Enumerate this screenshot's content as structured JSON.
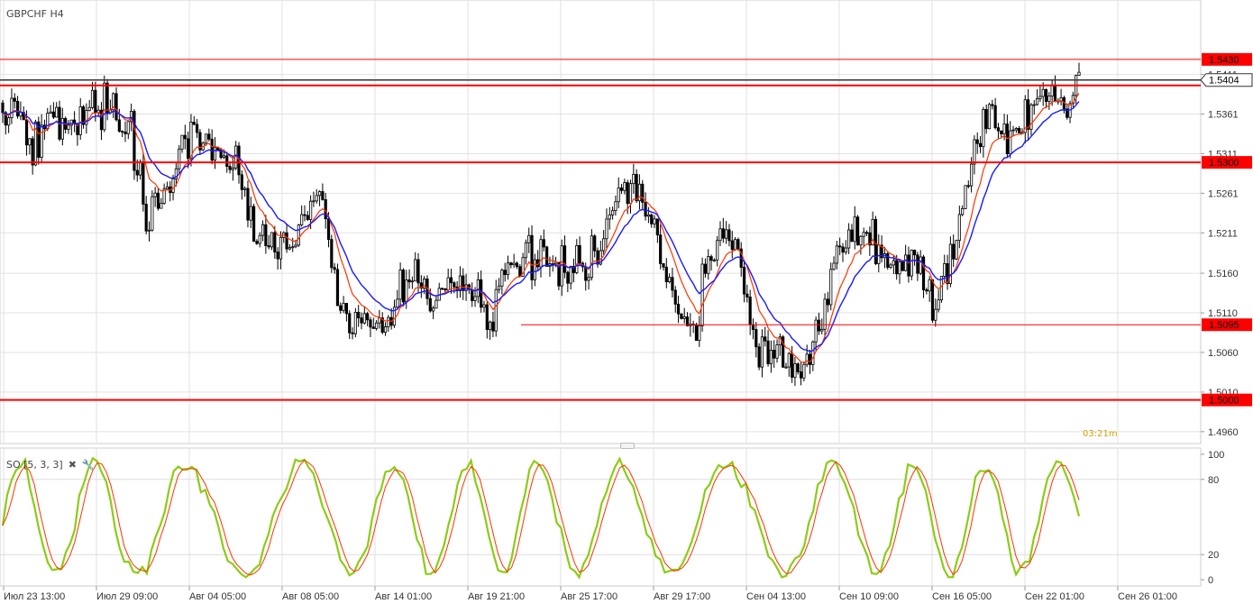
{
  "chart_data": [
    {
      "type": "candlestick",
      "title": "GBPCHF H4",
      "ylim": [
        1.4945,
        1.5505
      ],
      "y_ticks": [
        "1.5411",
        "1.5361",
        "1.5311",
        "1.5261",
        "1.5211",
        "1.5160",
        "1.5110",
        "1.5060",
        "1.5010",
        "1.4960"
      ],
      "x_ticks": [
        "Июл 23 13:00",
        "Июл 29 09:00",
        "Авг 04 05:00",
        "Авг 08 05:00",
        "Авг 14 01:00",
        "Авг 19 21:00",
        "Авг 25 17:00",
        "Авг 29 17:00",
        "Сен 04 13:00",
        "Сен 10 09:00",
        "Сен 16 05:00",
        "Сен 22 01:00",
        "Сен 26 01:00"
      ],
      "grid": true,
      "series_ma_fast_color": "#ff3300",
      "series_ma_slow_color": "#1a1aff",
      "candle_color": "#000000",
      "price_anchors": [
        [
          0,
          1.5375
        ],
        [
          5,
          1.536
        ],
        [
          10,
          1.531
        ],
        [
          14,
          1.5355
        ],
        [
          20,
          1.5355
        ],
        [
          30,
          1.5365
        ],
        [
          36,
          1.5375
        ],
        [
          43,
          1.5335
        ],
        [
          48,
          1.524
        ],
        [
          54,
          1.5255
        ],
        [
          60,
          1.531
        ],
        [
          66,
          1.534
        ],
        [
          72,
          1.53
        ],
        [
          78,
          1.53
        ],
        [
          84,
          1.523
        ],
        [
          90,
          1.519
        ],
        [
          97,
          1.521
        ],
        [
          103,
          1.524
        ],
        [
          106,
          1.527
        ],
        [
          110,
          1.516
        ],
        [
          116,
          1.509
        ],
        [
          122,
          1.509
        ],
        [
          128,
          1.508
        ],
        [
          133,
          1.514
        ],
        [
          140,
          1.516
        ],
        [
          144,
          1.511
        ],
        [
          150,
          1.514
        ],
        [
          158,
          1.513
        ],
        [
          163,
          1.51
        ],
        [
          170,
          1.518
        ],
        [
          176,
          1.518
        ],
        [
          182,
          1.518
        ],
        [
          188,
          1.517
        ],
        [
          194,
          1.5175
        ],
        [
          200,
          1.519
        ],
        [
          206,
          1.526
        ],
        [
          212,
          1.527
        ],
        [
          218,
          1.522
        ],
        [
          222,
          1.516
        ],
        [
          228,
          1.511
        ],
        [
          232,
          1.5105
        ],
        [
          236,
          1.519
        ],
        [
          241,
          1.52
        ],
        [
          246,
          1.518
        ],
        [
          252,
          1.506
        ],
        [
          258,
          1.506
        ],
        [
          264,
          1.505
        ],
        [
          270,
          1.504
        ],
        [
          276,
          1.514
        ],
        [
          282,
          1.521
        ],
        [
          288,
          1.521
        ],
        [
          294,
          1.518
        ],
        [
          300,
          1.517
        ],
        [
          306,
          1.518
        ],
        [
          311,
          1.512
        ],
        [
          316,
          1.516
        ],
        [
          322,
          1.528
        ],
        [
          328,
          1.536
        ],
        [
          334,
          1.534
        ],
        [
          340,
          1.535
        ],
        [
          346,
          1.539
        ],
        [
          352,
          1.539
        ],
        [
          356,
          1.5355
        ],
        [
          360,
          1.5405
        ]
      ],
      "levels": [
        {
          "value": 1.543,
          "label": "1.5430",
          "style": "thin"
        },
        {
          "value": 1.5404,
          "label": "1.5404",
          "style": "current"
        },
        {
          "value": 1.53,
          "label": "1.5300",
          "style": "thick"
        },
        {
          "value": 1.5095,
          "label": "1.5095",
          "style": "thin"
        },
        {
          "value": 1.5,
          "label": "1.5000",
          "style": "thick"
        }
      ],
      "candle_count": 361,
      "seed": 20240901
    },
    {
      "type": "line",
      "title": "SO [5, 3, 3]",
      "ylim": [
        -5,
        105
      ],
      "y_ticks": [
        "100",
        "80",
        "20",
        "0"
      ],
      "series_k_color": "#8ccc14",
      "series_d_color": "#ff3300",
      "levels": [
        80,
        20
      ]
    }
  ],
  "countdown": "03:21m",
  "icons": {
    "close": "close-icon",
    "settings": "wrench-icon"
  },
  "colors": {
    "level_red": "#ff0000",
    "grid": "#e2e2e2",
    "axis_label": "#333333"
  }
}
